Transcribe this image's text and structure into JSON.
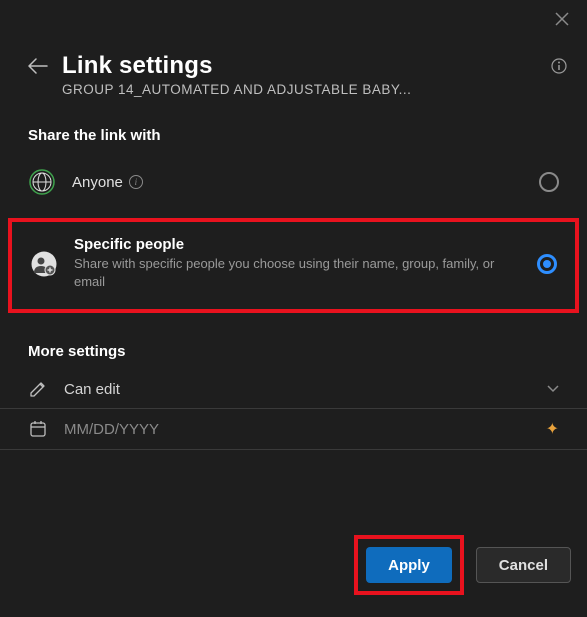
{
  "header": {
    "title": "Link settings",
    "subtitle": "GROUP 14_AUTOMATED AND ADJUSTABLE BABY..."
  },
  "share_section": {
    "label": "Share the link with",
    "options": [
      {
        "title": "Anyone",
        "desc": "",
        "selected": false
      },
      {
        "title": "Specific people",
        "desc": "Share with specific people you choose using their name, group, family, or email",
        "selected": true
      }
    ]
  },
  "more_settings": {
    "label": "More settings",
    "permission": "Can edit",
    "date_placeholder": "MM/DD/YYYY"
  },
  "footer": {
    "apply": "Apply",
    "cancel": "Cancel"
  }
}
